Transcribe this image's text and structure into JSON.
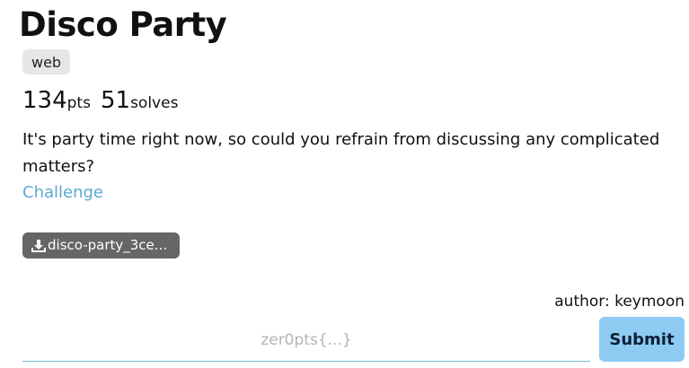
{
  "challenge": {
    "title": "Disco Party",
    "category": "web",
    "points": "134",
    "points_unit": "pts",
    "solves": "51",
    "solves_unit": "solves",
    "description": "It's party time right now, so could you refrain from discussing any complicated matters?",
    "link_label": "Challenge",
    "download_label": "disco-party_3ce...",
    "author": "author: keymoon"
  },
  "submission": {
    "placeholder": "zer0pts{...}",
    "value": "",
    "submit_label": "Submit"
  },
  "icons": {
    "download": "download-icon"
  },
  "colors": {
    "link": "#5fa9cf",
    "submit_bg": "#8ecbf2",
    "download_bg": "#666666",
    "tag_bg": "#e6e6e6"
  }
}
